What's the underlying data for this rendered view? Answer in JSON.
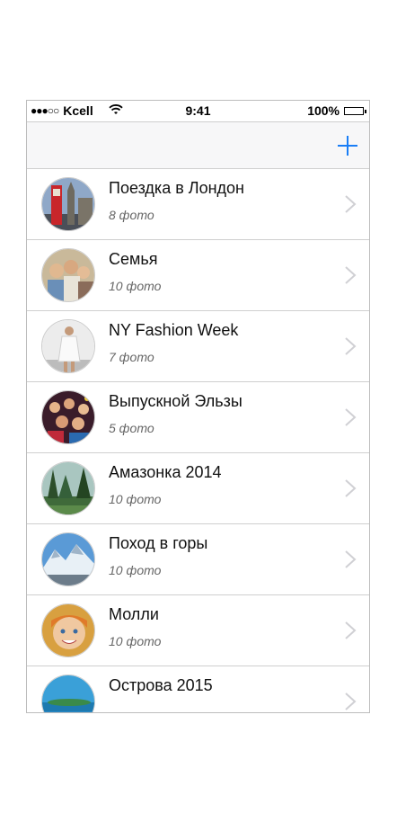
{
  "status_bar": {
    "signal": "●●●○○",
    "carrier": "Kcell",
    "time": "9:41",
    "battery": "100%"
  },
  "navbar": {
    "add_icon": "plus-icon",
    "accent": "#1a7ef6"
  },
  "albums": [
    {
      "title": "Поездка в Лондон",
      "count": "8 фото",
      "thumb": "london"
    },
    {
      "title": "Семья",
      "count": "10 фото",
      "thumb": "family"
    },
    {
      "title": "NY Fashion Week",
      "count": "7 фото",
      "thumb": "fashion"
    },
    {
      "title": "Выпускной Эльзы",
      "count": "5 фото",
      "thumb": "party"
    },
    {
      "title": "Амазонка 2014",
      "count": "10 фото",
      "thumb": "forest"
    },
    {
      "title": "Поход в горы",
      "count": "10 фото",
      "thumb": "mountains"
    },
    {
      "title": "Молли",
      "count": "10 фото",
      "thumb": "child"
    },
    {
      "title": "Острова 2015",
      "count": "",
      "thumb": "islands"
    }
  ]
}
